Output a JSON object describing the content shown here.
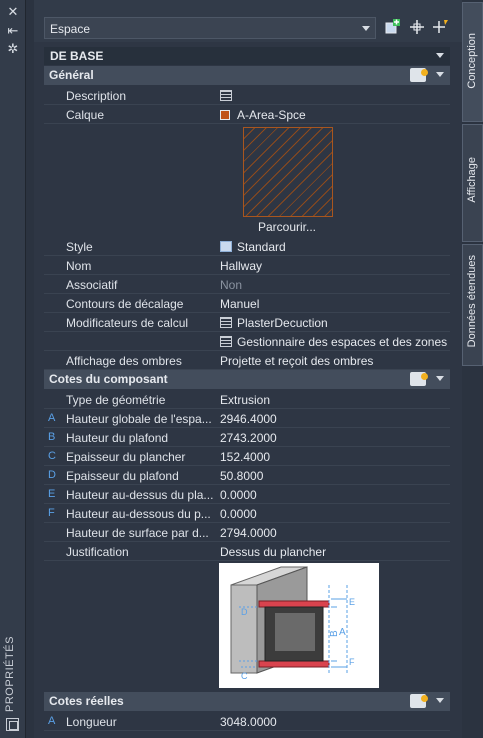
{
  "palette": {
    "title": "PROPRIÉTÉS"
  },
  "selector": {
    "value": "Espace"
  },
  "toolbar_icons": [
    "quick-select-icon",
    "pickadd-icon",
    "select-objects-icon"
  ],
  "main_section": "DE BASE",
  "general": {
    "title": "Général",
    "rows": [
      {
        "label": "Description",
        "value": ""
      },
      {
        "label": "Calque",
        "value": "A-Area-Spce"
      }
    ],
    "browse": "Parcourir...",
    "rows2": [
      {
        "label": "Style",
        "value": "Standard"
      },
      {
        "label": "Nom",
        "value": "Hallway"
      },
      {
        "label": "Associatif",
        "value": "Non"
      },
      {
        "label": "Contours de décalage",
        "value": "Manuel"
      },
      {
        "label": "Modificateurs de calcul",
        "value": "PlasterDecuction"
      },
      {
        "label": "",
        "value": "Gestionnaire des espaces et des zones"
      },
      {
        "label": "Affichage des ombres",
        "value": "Projette et reçoit des ombres"
      }
    ]
  },
  "component": {
    "title": "Cotes du composant",
    "rows": [
      {
        "abbr": "",
        "label": "Type de géométrie",
        "value": "Extrusion"
      },
      {
        "abbr": "A",
        "label": "Hauteur globale de l'espa...",
        "value": "2946.4000"
      },
      {
        "abbr": "B",
        "label": "Hauteur du plafond",
        "value": "2743.2000"
      },
      {
        "abbr": "C",
        "label": "Epaisseur du plancher",
        "value": "152.4000"
      },
      {
        "abbr": "D",
        "label": "Epaisseur du plafond",
        "value": "50.8000"
      },
      {
        "abbr": "E",
        "label": "Hauteur au-dessus du pla...",
        "value": "0.0000"
      },
      {
        "abbr": "F",
        "label": "Hauteur au-dessous du p...",
        "value": "0.0000"
      },
      {
        "abbr": "",
        "label": "Hauteur de surface par d...",
        "value": "2794.0000"
      },
      {
        "abbr": "",
        "label": "Justification",
        "value": "Dessus du plancher"
      }
    ],
    "figure_labels": [
      "A",
      "B",
      "C",
      "D",
      "E",
      "F"
    ]
  },
  "actual": {
    "title": "Cotes réelles",
    "rows": [
      {
        "abbr": "A",
        "label": "Longueur",
        "value": "3048.0000"
      }
    ]
  },
  "tabs": [
    "Conception",
    "Affichage",
    "Données étendues"
  ]
}
